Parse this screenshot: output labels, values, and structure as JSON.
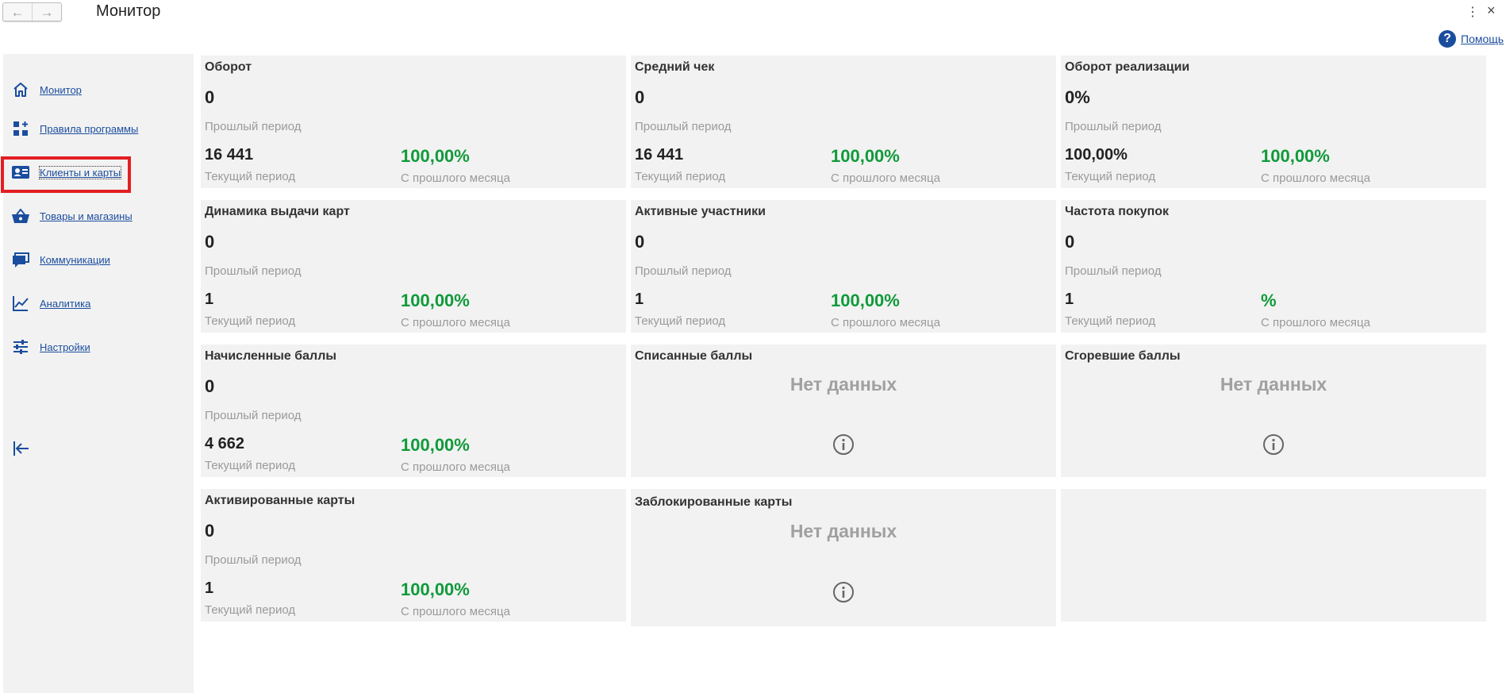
{
  "window": {
    "title": "Монитор",
    "back_icon": "←",
    "forward_icon": "→",
    "menu_icon": "⋮",
    "close_icon": "×"
  },
  "help": {
    "icon": "?",
    "label": "Помощь"
  },
  "sidebar": {
    "items": [
      {
        "label": "Монитор",
        "icon": "home-icon"
      },
      {
        "label": "Правила программы",
        "icon": "grid-plus-icon"
      },
      {
        "label": "Клиенты и карты",
        "icon": "id-card-icon",
        "active": true
      },
      {
        "label": "Товары и магазины",
        "icon": "basket-icon"
      },
      {
        "label": "Коммуникации",
        "icon": "chat-icon"
      },
      {
        "label": "Аналитика",
        "icon": "chart-line-icon"
      },
      {
        "label": "Настройки",
        "icon": "sliders-icon"
      }
    ],
    "collapse_icon": "collapse-left-icon"
  },
  "cards": [
    {
      "title": "Оборот",
      "prev_value": "0",
      "prev_label": "Прошлый период",
      "cur_value": "16 441",
      "cur_label": "Текущий период",
      "pct": "100,00%",
      "pct_label": "С прошлого месяца"
    },
    {
      "title": "Средний чек",
      "prev_value": "0",
      "prev_label": "Прошлый период",
      "cur_value": "16 441",
      "cur_label": "Текущий период",
      "pct": "100,00%",
      "pct_label": "С прошлого месяца"
    },
    {
      "title": "Оборот реализации",
      "prev_value": "0%",
      "prev_label": "Прошлый период",
      "cur_value": "100,00%",
      "cur_label": "Текущий период",
      "pct": "100,00%",
      "pct_label": "С прошлого месяца"
    },
    {
      "title": "Динамика выдачи карт",
      "prev_value": "0",
      "prev_label": "Прошлый период",
      "cur_value": "1",
      "cur_label": "Текущий период",
      "pct": "100,00%",
      "pct_label": "С прошлого месяца"
    },
    {
      "title": "Активные участники",
      "prev_value": "0",
      "prev_label": "Прошлый период",
      "cur_value": "1",
      "cur_label": "Текущий период",
      "pct": "100,00%",
      "pct_label": "С прошлого месяца"
    },
    {
      "title": "Частота покупок",
      "prev_value": "0",
      "prev_label": "Прошлый период",
      "cur_value": "1",
      "cur_label": "Текущий период",
      "pct": "%",
      "pct_label": "С прошлого месяца"
    },
    {
      "title": "Начисленные баллы",
      "prev_value": "0",
      "prev_label": "Прошлый период",
      "cur_value": "4 662",
      "cur_label": "Текущий период",
      "pct": "100,00%",
      "pct_label": "С прошлого месяца"
    },
    {
      "title": "Списанные баллы",
      "nodata": "Нет данных"
    },
    {
      "title": "Сгоревшие баллы",
      "nodata": "Нет данных"
    },
    {
      "title": "Активированные карты",
      "prev_value": "0",
      "prev_label": "Прошлый период",
      "cur_value": "1",
      "cur_label": "Текущий период",
      "pct": "100,00%",
      "pct_label": "С прошлого месяца"
    },
    {
      "title": "Заблокированные карты",
      "nodata": "Нет данных"
    }
  ],
  "colors": {
    "accent": "#1a4d9e",
    "positive": "#0f9a3a",
    "highlight": "#e31e24",
    "panel": "#f2f2f2"
  }
}
